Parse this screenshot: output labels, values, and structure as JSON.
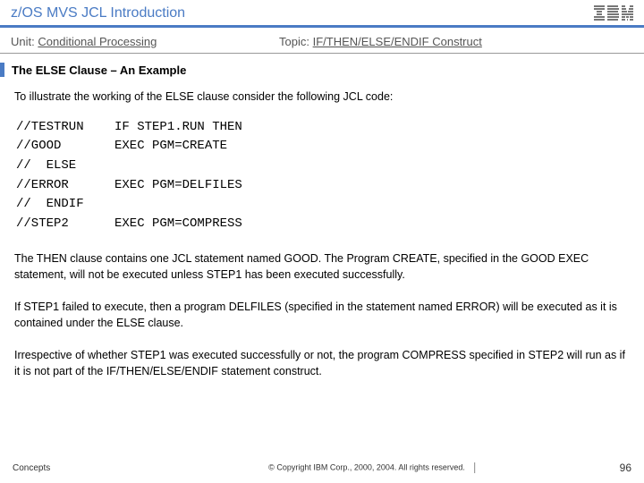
{
  "header": {
    "title": "z/OS MVS JCL Introduction",
    "unit_label": "Unit:",
    "unit_value": "Conditional Processing",
    "topic_label": "Topic:",
    "topic_value": "IF/THEN/ELSE/ENDIF Construct"
  },
  "section": {
    "title": "The ELSE Clause – An Example",
    "intro": "To illustrate the working of the ELSE clause consider the following JCL code:"
  },
  "code": {
    "rows": [
      {
        "c1": "//TESTRUN",
        "c2": "IF STEP1.RUN THEN"
      },
      {
        "c1": "//GOOD",
        "c2": "EXEC PGM=CREATE"
      },
      {
        "c1": "//  ELSE",
        "c2": ""
      },
      {
        "c1": "//ERROR",
        "c2": "EXEC PGM=DELFILES"
      },
      {
        "c1": "//  ENDIF",
        "c2": ""
      },
      {
        "c1": "//STEP2",
        "c2": "EXEC PGM=COMPRESS"
      }
    ]
  },
  "paragraphs": {
    "p1": "The THEN clause contains one JCL statement named GOOD. The Program CREATE, specified in the GOOD EXEC statement, will not be executed unless STEP1 has been executed successfully.",
    "p2": "If STEP1 failed to execute, then a program DELFILES (specified in the statement named ERROR) will be executed as it is contained under the ELSE clause.",
    "p3": "Irrespective of whether STEP1 was executed successfully or not, the program COMPRESS specified in STEP2 will run as if it is not part of the IF/THEN/ELSE/ENDIF statement construct."
  },
  "footer": {
    "left": "Concepts",
    "copyright": "© Copyright IBM Corp., 2000, 2004. All rights reserved.",
    "page": "96"
  }
}
